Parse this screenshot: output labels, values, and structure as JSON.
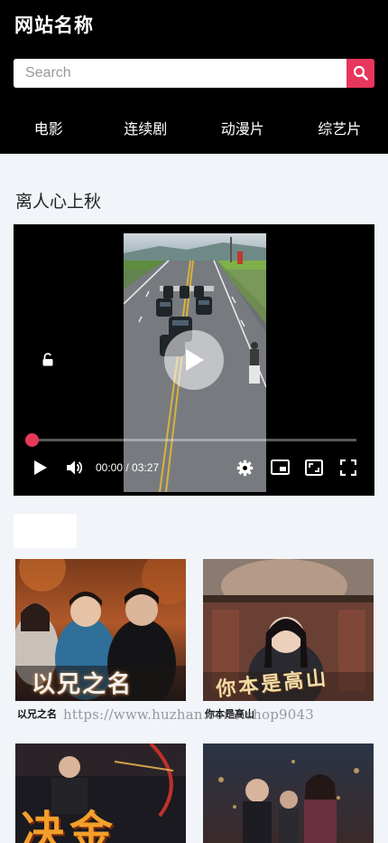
{
  "header": {
    "site_title": "网站名称",
    "search_placeholder": "Search"
  },
  "nav": {
    "items": [
      "电影",
      "连续剧",
      "动漫片",
      "综艺片"
    ]
  },
  "video": {
    "title": "离人心上秋",
    "current_time": "00:00",
    "duration": "03:27",
    "time_display": "00:00 / 03:27",
    "progress": 0
  },
  "cards": [
    {
      "title": "以兄之名",
      "poster_text": "以兄之名"
    },
    {
      "title": "你本是高山",
      "poster_text": "你本是高山"
    },
    {
      "title": "",
      "poster_text": "决金"
    },
    {
      "title": "",
      "poster_text": ""
    }
  ],
  "watermark": "https://www.huzhan.com/ishop9043",
  "colors": {
    "accent": "#e8375d",
    "header_bg": "#000000",
    "page_bg": "#f1f4f8"
  }
}
